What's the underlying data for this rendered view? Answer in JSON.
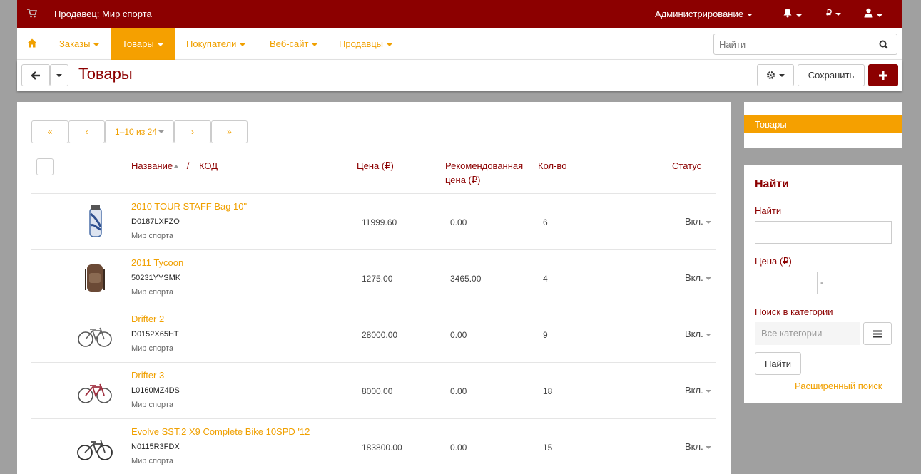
{
  "topbar": {
    "vendor": "Продавец: Мир спорта",
    "admin": "Администрирование",
    "currency": "₽"
  },
  "nav": {
    "items": [
      {
        "label": "Заказы"
      },
      {
        "label": "Товары"
      },
      {
        "label": "Покупатели"
      },
      {
        "label": "Веб-сайт"
      },
      {
        "label": "Продавцы"
      }
    ],
    "active": "Товары",
    "search_placeholder": "Найти"
  },
  "toolbar": {
    "title": "Товары",
    "save_label": "Сохранить"
  },
  "pager": {
    "first": "«",
    "prev": "‹",
    "range": "1–10 из 24",
    "next": "›",
    "last": "»"
  },
  "table": {
    "headers": {
      "name": "Название",
      "separator": "/",
      "code": "КОД",
      "price": "Цена (₽)",
      "recommended_line1": "Рекомендованная",
      "recommended_line2": "цена (₽)",
      "qty": "Кол-во",
      "status": "Статус"
    },
    "rows": [
      {
        "name": "2010 TOUR STAFF Bag 10\"",
        "code": "D0187LXFZO",
        "vendor": "Мир спорта",
        "price": "11999.60",
        "rec_price": "0.00",
        "qty": "6",
        "status": "Вкл.",
        "thumb": "golf-bag-image"
      },
      {
        "name": "2011 Tycoon",
        "code": "50231YYSMK",
        "vendor": "Мир спорта",
        "price": "1275.00",
        "rec_price": "3465.00",
        "qty": "4",
        "status": "Вкл.",
        "thumb": "backpack-image"
      },
      {
        "name": "Drifter 2",
        "code": "D0152X65HT",
        "vendor": "Мир спорта",
        "price": "28000.00",
        "rec_price": "0.00",
        "qty": "9",
        "status": "Вкл.",
        "thumb": "bicycle-image"
      },
      {
        "name": "Drifter 3",
        "code": "L0160MZ4DS",
        "vendor": "Мир спорта",
        "price": "8000.00",
        "rec_price": "0.00",
        "qty": "18",
        "status": "Вкл.",
        "thumb": "bicycle-image"
      },
      {
        "name": "Evolve SST.2 X9 Complete Bike 10SPD '12",
        "code": "N0115R3FDX",
        "vendor": "Мир спорта",
        "price": "183800.00",
        "rec_price": "0.00",
        "qty": "15",
        "status": "Вкл.",
        "thumb": "bicycle-image"
      }
    ]
  },
  "sidebar": {
    "category": "Товары",
    "search": {
      "heading": "Найти",
      "name_label": "Найти",
      "price_label": "Цена (₽)",
      "price_separator": "-",
      "category_label": "Поиск в категории",
      "category_placeholder": "Все категории",
      "submit": "Найти",
      "advanced": "Расширенный поиск"
    }
  },
  "colors": {
    "brand": "#8c0000",
    "accent": "#f5a000"
  }
}
